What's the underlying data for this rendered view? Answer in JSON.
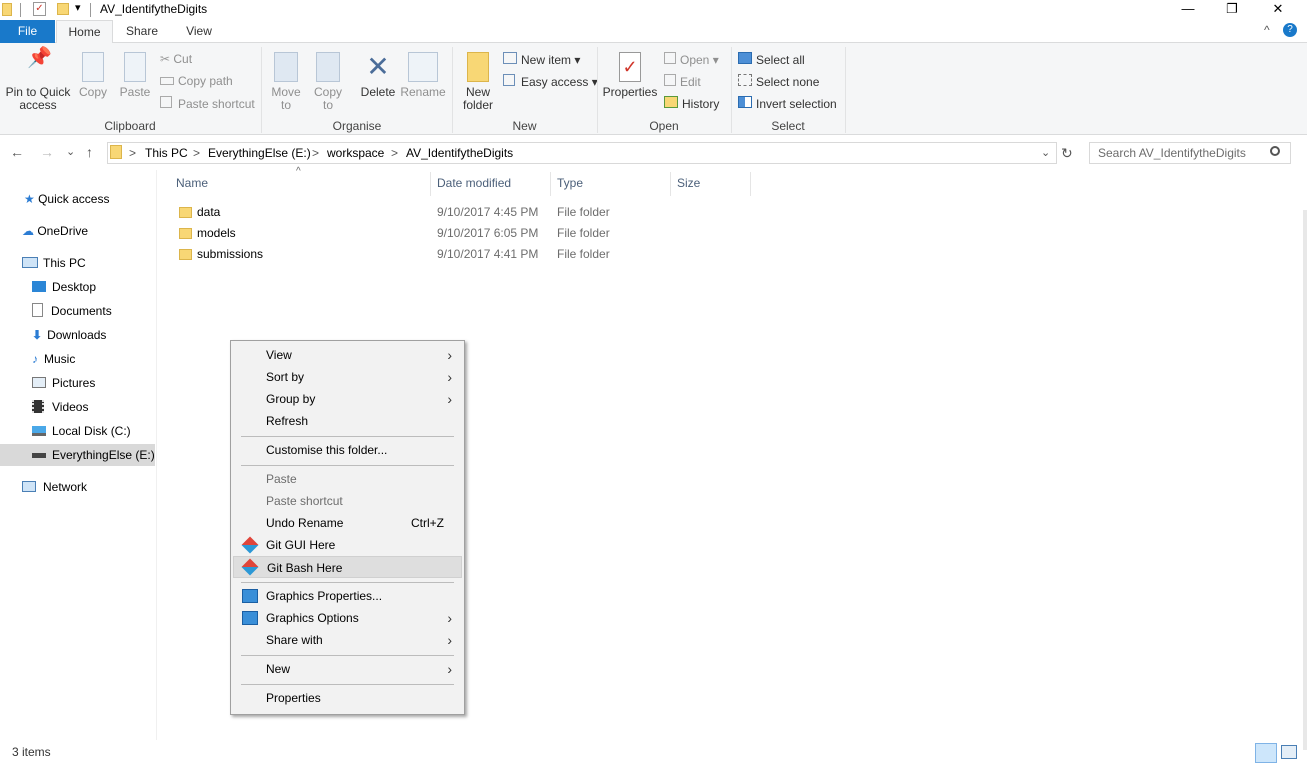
{
  "window": {
    "title": "AV_IdentifytheDigits",
    "minimize": "—",
    "restore": "❐",
    "close": "✕",
    "qat_dropdown": "▾"
  },
  "ribbon_tabs": [
    "File",
    "Home",
    "Share",
    "View"
  ],
  "ribbon_controls": {
    "collapse": "^",
    "help": "?"
  },
  "ribbon": {
    "clipboard": {
      "label": "Clipboard",
      "pin": "Pin to Quick access",
      "copy": "Copy",
      "paste": "Paste",
      "cut": "Cut",
      "copy_path": "Copy path",
      "paste_shortcut": "Paste shortcut"
    },
    "organise": {
      "label": "Organise",
      "move_to": "Move to",
      "copy_to": "Copy to",
      "delete": "Delete",
      "rename": "Rename"
    },
    "new": {
      "label": "New",
      "new_folder": "New folder",
      "new_item": "New item",
      "easy_access": "Easy access"
    },
    "open": {
      "label": "Open",
      "properties": "Properties",
      "open": "Open",
      "edit": "Edit",
      "history": "History"
    },
    "select": {
      "label": "Select",
      "select_all": "Select all",
      "select_none": "Select none",
      "invert": "Invert selection"
    }
  },
  "address": {
    "breadcrumbs": [
      "This PC",
      "EverythingElse (E:)",
      "workspace",
      "AV_IdentifytheDigits"
    ],
    "separator": ">",
    "back": "←",
    "forward": "→",
    "recent": "⌄",
    "up": "↑",
    "dropdown": "⌄",
    "refresh": "↻",
    "search_placeholder": "Search AV_IdentifytheDigits"
  },
  "nav": {
    "quick_access": "Quick access",
    "onedrive": "OneDrive",
    "this_pc": "This PC",
    "desktop": "Desktop",
    "documents": "Documents",
    "downloads": "Downloads",
    "music": "Music",
    "pictures": "Pictures",
    "videos": "Videos",
    "local_disk": "Local Disk (C:)",
    "everything_else": "EverythingElse (E:)",
    "network": "Network"
  },
  "columns": {
    "name": "Name",
    "date": "Date modified",
    "type": "Type",
    "size": "Size",
    "sort_indicator": "^"
  },
  "files": [
    {
      "name": "data",
      "date": "9/10/2017 4:45 PM",
      "type": "File folder"
    },
    {
      "name": "models",
      "date": "9/10/2017 6:05 PM",
      "type": "File folder"
    },
    {
      "name": "submissions",
      "date": "9/10/2017 4:41 PM",
      "type": "File folder"
    }
  ],
  "status": {
    "items": "3 items"
  },
  "context_menu": {
    "view": "View",
    "sort_by": "Sort by",
    "group_by": "Group by",
    "refresh": "Refresh",
    "customise": "Customise this folder...",
    "paste": "Paste",
    "paste_shortcut": "Paste shortcut",
    "undo_rename": "Undo Rename",
    "undo_shortcut": "Ctrl+Z",
    "git_gui": "Git GUI Here",
    "git_bash": "Git Bash Here",
    "graphics_properties": "Graphics Properties...",
    "graphics_options": "Graphics Options",
    "share_with": "Share with",
    "new": "New",
    "properties": "Properties",
    "submenu_arrow": "›"
  },
  "colors": {
    "file_tab": "#1979ca",
    "folder": "#f8d775",
    "ribbon_bg": "#f5f6f7",
    "selected_nav": "#d9d9d9"
  }
}
